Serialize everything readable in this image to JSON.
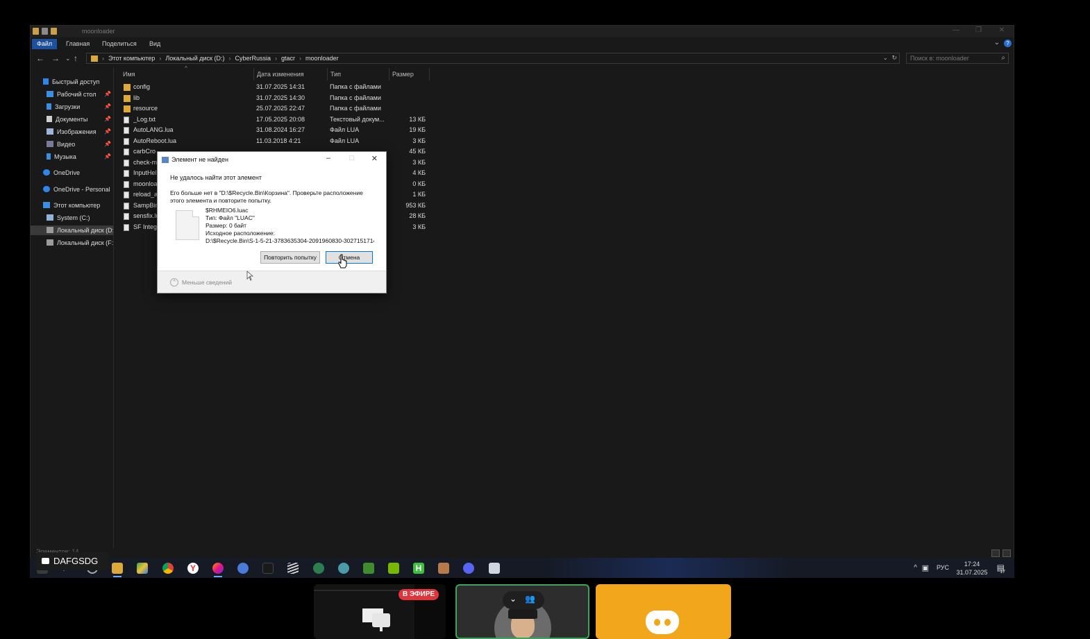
{
  "explorer": {
    "title": "moonloader",
    "ribbon_tabs": [
      "Файл",
      "Главная",
      "Поделиться",
      "Вид"
    ],
    "breadcrumbs": [
      "Этот компьютер",
      "Локальный диск (D:)",
      "CyberRussia",
      "gtacr",
      "moonloader"
    ],
    "search_placeholder": "Поиск в: moonloader",
    "columns": [
      "Имя",
      "Дата изменения",
      "Тип",
      "Размер"
    ],
    "nav": {
      "quick_access": "Быстрый доступ",
      "desktop": "Рабочий стол",
      "downloads": "Загрузки",
      "documents": "Документы",
      "pictures": "Изображения",
      "videos": "Видео",
      "music": "Музыка",
      "onedrive": "OneDrive",
      "onedrive_personal": "OneDrive - Personal",
      "this_pc": "Этот компьютер",
      "system_c": "System (C:)",
      "local_d": "Локальный диск (D:",
      "local_f": "Локальный диск (F:"
    },
    "files": [
      {
        "name": "config",
        "date": "31.07.2025 14:31",
        "type": "Папка с файлами",
        "size": "",
        "kind": "folder"
      },
      {
        "name": "lib",
        "date": "31.07.2025 14:30",
        "type": "Папка с файлами",
        "size": "",
        "kind": "folder"
      },
      {
        "name": "resource",
        "date": "25.07.2025 22:47",
        "type": "Папка с файлами",
        "size": "",
        "kind": "folder"
      },
      {
        "name": "_Log.txt",
        "date": "17.05.2025 20:08",
        "type": "Текстовый докум...",
        "size": "13 КБ",
        "kind": "file"
      },
      {
        "name": "AutoLANG.lua",
        "date": "31.08.2024 16:27",
        "type": "Файл LUA",
        "size": "19 КБ",
        "kind": "file"
      },
      {
        "name": "AutoReboot.lua",
        "date": "11.03.2018 4:21",
        "type": "Файл LUA",
        "size": "3 КБ",
        "kind": "file"
      },
      {
        "name": "carbCro",
        "date": "",
        "type": "",
        "size": "45 КБ",
        "kind": "file"
      },
      {
        "name": "check-m",
        "date": "",
        "type": "",
        "size": "3 КБ",
        "kind": "file"
      },
      {
        "name": "InputHel",
        "date": "",
        "type": "",
        "size": "4 КБ",
        "kind": "file"
      },
      {
        "name": "moonloa",
        "date": "",
        "type": "",
        "size": "0 КБ",
        "kind": "file"
      },
      {
        "name": "reload_a",
        "date": "",
        "type": "",
        "size": "1 КБ",
        "kind": "file"
      },
      {
        "name": "SampBin",
        "date": "",
        "type": "",
        "size": "953 КБ",
        "kind": "file"
      },
      {
        "name": "sensfix.lu",
        "date": "",
        "type": "",
        "size": "28 КБ",
        "kind": "file"
      },
      {
        "name": "SF Integr",
        "date": "",
        "type": "",
        "size": "3 КБ",
        "kind": "file"
      }
    ],
    "status_text": "Элементов: 14"
  },
  "dialog": {
    "title": "Элемент не найден",
    "heading": "Не удалось найти этот элемент",
    "message": "Его больше нет в \"D:\\$Recycle.Bin\\Корзина\". Проверьте расположение этого элемента и повторите попытку.",
    "file_name": "$RHMEIO6.luac",
    "file_type": "Тип: Файл \"LUAC\"",
    "file_size": "Размер: 0 байт",
    "original_location_label": "Исходное расположение:",
    "original_location": "D:\\$Recycle.Bin\\S-1-5-21-3783635304-2091960830-3027151714",
    "retry_label": "Повторить попытку",
    "cancel_label": "Отмена",
    "less_details_label": "Меньше сведений"
  },
  "taskbar": {
    "language": "РУС",
    "time": "17:24",
    "date": "31.07.2025",
    "notifications_count": "17"
  },
  "stream": {
    "user_label": "DAFGSDG",
    "live_badge": "В ЭФИРЕ"
  },
  "colors": {
    "accent": "#1e4f9c",
    "folder": "#dca93a",
    "live": "#e0353b",
    "speaking": "#3ba55c",
    "discord_tile": "#f1a61b"
  }
}
